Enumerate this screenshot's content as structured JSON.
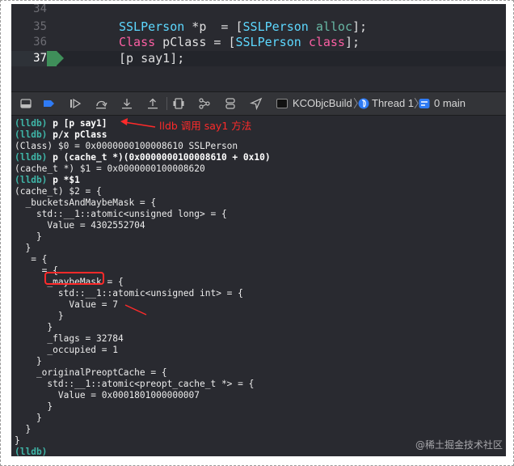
{
  "editor": {
    "lines": [
      {
        "num": "34",
        "text": ""
      },
      {
        "num": "35",
        "parts": [
          {
            "t": "SSLPerson",
            "c": "class"
          },
          {
            "t": " *p  = [",
            "c": ""
          },
          {
            "t": "SSLPerson",
            "c": "class"
          },
          {
            "t": " ",
            "c": ""
          },
          {
            "t": "alloc",
            "c": "sel"
          },
          {
            "t": "];",
            "c": ""
          }
        ]
      },
      {
        "num": "36",
        "parts": [
          {
            "t": "Class",
            "c": "kw"
          },
          {
            "t": " pClass = [",
            "c": ""
          },
          {
            "t": "SSLPerson",
            "c": "class"
          },
          {
            "t": " ",
            "c": ""
          },
          {
            "t": "class",
            "c": "kw"
          },
          {
            "t": "];",
            "c": ""
          }
        ]
      },
      {
        "num": "37",
        "current": true,
        "parts": [
          {
            "t": "[p say1];",
            "c": ""
          }
        ]
      }
    ]
  },
  "debug_bar": {
    "icons": [
      "console-toggle-icon",
      "breakpoints-toggle-icon",
      "continue-icon",
      "step-over-icon",
      "step-into-icon",
      "step-out-icon",
      "view-debugger-icon",
      "memory-graph-icon",
      "environment-icon",
      "location-icon"
    ],
    "breadcrumb": {
      "target": "KCObjcBuild",
      "thread": "Thread 1",
      "frame": "0 main"
    }
  },
  "console": {
    "lines": [
      {
        "prompt": "(lldb)",
        "cmd": " p [p say1]"
      },
      {
        "prompt": "(lldb)",
        "cmd": " p/x pClass"
      },
      {
        "text": "(Class) $0 = 0x0000000100008610 SSLPerson"
      },
      {
        "prompt": "(lldb)",
        "cmd": " p (cache_t *)(0x0000000100008610 + 0x10)"
      },
      {
        "text": "(cache_t *) $1 = 0x0000000100008620"
      },
      {
        "prompt": "(lldb)",
        "cmd": " p *$1"
      },
      {
        "text": "(cache_t) $2 = {"
      },
      {
        "text": "  _bucketsAndMaybeMask = {"
      },
      {
        "text": "    std::__1::atomic<unsigned long> = {"
      },
      {
        "text": "      Value = 4302552704"
      },
      {
        "text": "    }"
      },
      {
        "text": "  }"
      },
      {
        "text": "   = {"
      },
      {
        "text": "     = {"
      },
      {
        "text": "      _maybeMask = {"
      },
      {
        "text": "        std::__1::atomic<unsigned int> = {"
      },
      {
        "text": "          Value = 7"
      },
      {
        "text": "        }"
      },
      {
        "text": "      }"
      },
      {
        "text": "      _flags = 32784"
      },
      {
        "text": "      _occupied = 1"
      },
      {
        "text": "    }"
      },
      {
        "text": "    _originalPreoptCache = {"
      },
      {
        "text": "      std::__1::atomic<preopt_cache_t *> = {"
      },
      {
        "text": "        Value = 0x0001801000000007"
      },
      {
        "text": "      }"
      },
      {
        "text": "    }"
      },
      {
        "text": "  }"
      },
      {
        "text": "}"
      },
      {
        "prompt": "(lldb)",
        "cmd": ""
      }
    ]
  },
  "annotation": {
    "label": "lldb 调用 say1 方法",
    "color": "#ff2a2a"
  },
  "watermark": "@稀土掘金技术社区",
  "colors": {
    "background": "#292a30",
    "class_name": "#5dd8ff",
    "keyword": "#fc5fa3",
    "selector": "#67b7a4",
    "prompt": "#3fb6a8",
    "current_line_accent": "#3f8f5a"
  }
}
